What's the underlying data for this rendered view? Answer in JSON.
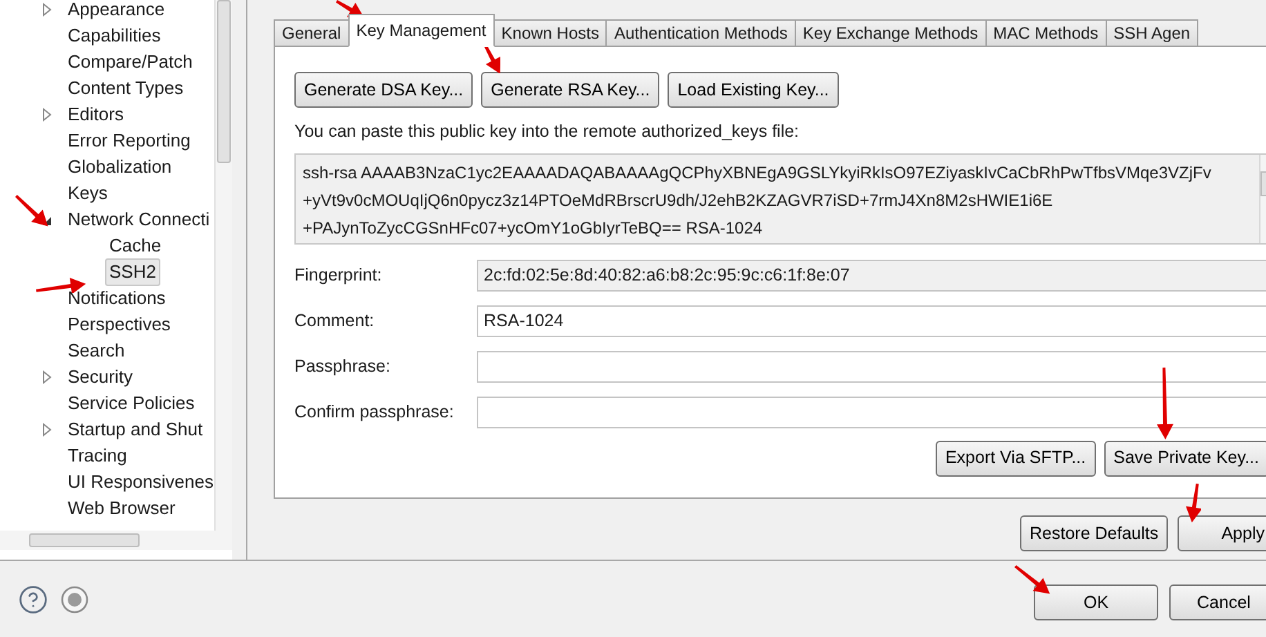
{
  "sidebar": {
    "items": [
      {
        "label": "Appearance",
        "expanded": false,
        "selected": false
      },
      {
        "label": "Capabilities",
        "selected": false
      },
      {
        "label": "Compare/Patch",
        "selected": false
      },
      {
        "label": "Content Types",
        "selected": false
      },
      {
        "label": "Editors",
        "expanded": false,
        "selected": false
      },
      {
        "label": "Error Reporting",
        "selected": false
      },
      {
        "label": "Globalization",
        "selected": false
      },
      {
        "label": "Keys",
        "selected": false
      },
      {
        "label": "Network Connecti",
        "expanded": true,
        "selected": false,
        "children": [
          {
            "label": "Cache",
            "selected": false
          },
          {
            "label": "SSH2",
            "selected": true
          }
        ]
      },
      {
        "label": "Notifications",
        "selected": false
      },
      {
        "label": "Perspectives",
        "selected": false
      },
      {
        "label": "Search",
        "selected": false
      },
      {
        "label": "Security",
        "expanded": false,
        "selected": false
      },
      {
        "label": "Service Policies",
        "selected": false
      },
      {
        "label": "Startup and Shut",
        "expanded": false,
        "selected": false
      },
      {
        "label": "Tracing",
        "selected": false
      },
      {
        "label": "UI Responsivenes",
        "selected": false
      },
      {
        "label": "Web Browser",
        "selected": false
      }
    ]
  },
  "tabs": [
    {
      "label": "General",
      "selected": false
    },
    {
      "label": "Key Management",
      "selected": true
    },
    {
      "label": "Known Hosts",
      "selected": false
    },
    {
      "label": "Authentication Methods",
      "selected": false
    },
    {
      "label": "Key Exchange Methods",
      "selected": false
    },
    {
      "label": "MAC Methods",
      "selected": false
    },
    {
      "label": "SSH Agen",
      "selected": false
    }
  ],
  "key_buttons": [
    "Generate DSA Key...",
    "Generate RSA Key...",
    "Load Existing Key..."
  ],
  "instruction": "You can paste this public key into the remote authorized_keys file:",
  "public_key_lines": [
    "ssh-rsa AAAAB3NzaC1yc2EAAAADAQABAAAAgQCPhyXBNEgA9GSLYkyiRkIsO97EZiyaskIvCaCbRhPwTfbsVMqe3VZjFv",
    "+yVt9v0cMOUqIjQ6n0pycz3z14PTOeMdRBrscrU9dh/J2ehB2KZAGVR7iSD+7rmJ4Xn8M2sHWIE1i6E",
    "+PAJynToZycCGSnHFc07+ycOmY1oGbIyrTeBQ== RSA-1024"
  ],
  "fields": [
    {
      "label": "Fingerprint:",
      "value": "2c:fd:02:5e:8d:40:82:a6:b8:2c:95:9c:c6:1f:8e:07",
      "read_only": true
    },
    {
      "label": "Comment:",
      "value": "RSA-1024",
      "read_only": false
    },
    {
      "label": "Passphrase:",
      "read_only": false
    },
    {
      "label": "Confirm passphrase:",
      "read_only": false
    }
  ],
  "key_actions": [
    "Export Via SFTP...",
    "Save Private Key..."
  ],
  "page_buttons": [
    "Restore Defaults",
    "Apply"
  ],
  "dialog_buttons": [
    "OK",
    "Cancel"
  ]
}
